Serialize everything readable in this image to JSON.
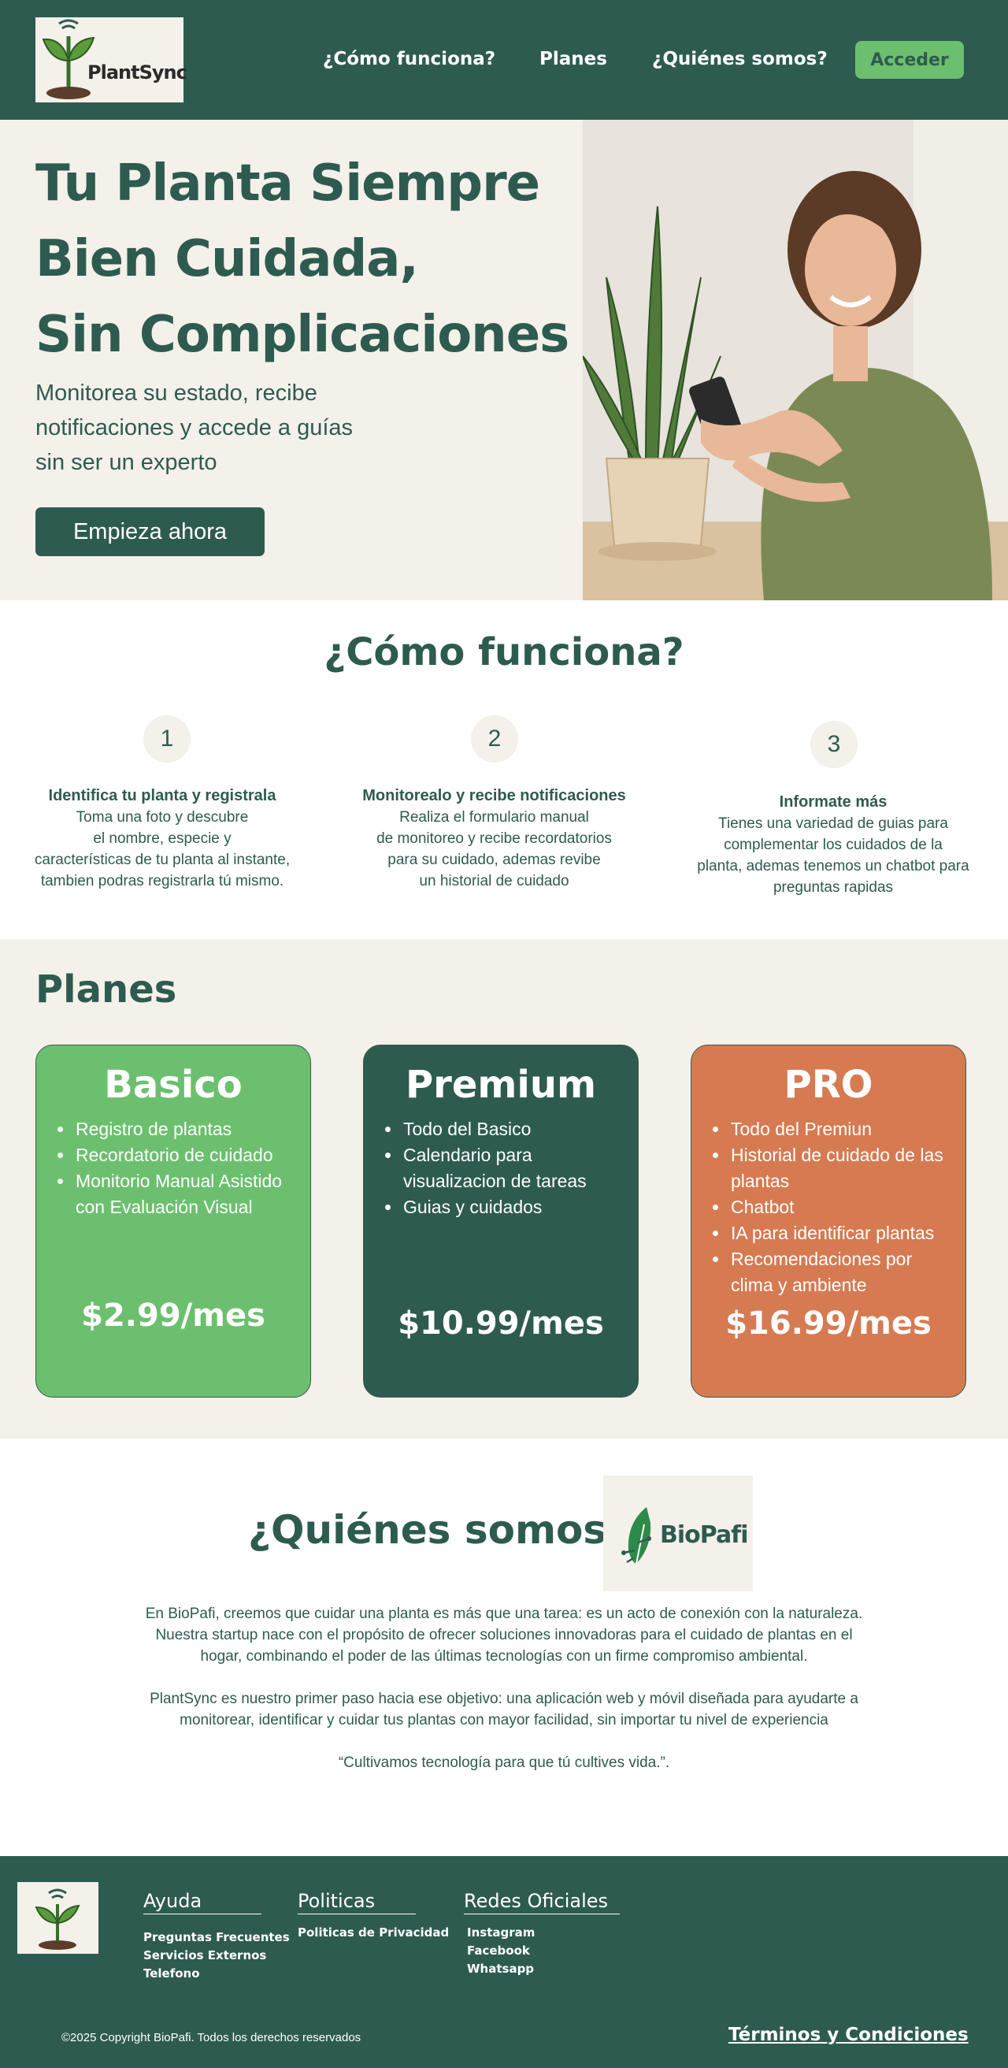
{
  "header": {
    "logo_text": "PlantSync",
    "nav": [
      "¿Cómo funciona?",
      "Planes",
      "¿Quiénes somos?"
    ],
    "login_button": "Acceder"
  },
  "hero": {
    "title_lines": [
      "Tu Planta Siempre",
      "Bien Cuidada,",
      "Sin Complicaciones"
    ],
    "subtitle_lines": [
      "Monitorea su estado, recibe",
      "notificaciones y accede a guías",
      "sin ser un experto"
    ],
    "cta_button": "Empieza ahora",
    "image": "woman-holding-phone-with-snake-plant-photo"
  },
  "how_it_works": {
    "title": "¿Cómo funciona?",
    "steps": [
      {
        "number": "1",
        "title": "Identifica tu planta y registrala",
        "lines": [
          "Toma una foto y descubre",
          "el nombre, especie y",
          "características de tu planta al instante,",
          "tambien podras registrarla tú mismo."
        ]
      },
      {
        "number": "2",
        "title": "Monitorealo y recibe notificaciones",
        "lines": [
          "Realiza el formulario manual",
          "de monitoreo y recibe recordatorios",
          "para su cuidado, ademas revibe",
          "un historial de cuidado"
        ]
      },
      {
        "number": "3",
        "title": "Informate más",
        "lines": [
          "Tienes una variedad de guias para",
          "complementar los cuidados de la",
          "planta, ademas tenemos un chatbot para",
          "preguntas rapidas"
        ]
      }
    ]
  },
  "plans": {
    "title": "Planes",
    "cards": [
      {
        "name": "Basico",
        "features": [
          "Registro de plantas",
          "Recordatorio de cuidado",
          "Monitorio Manual Asistido con Evaluación Visual"
        ],
        "price": "$2.99/mes",
        "color": "#6cbf6e"
      },
      {
        "name": "Premium",
        "features": [
          "Todo del Basico",
          "Calendario para visualizacion de tareas",
          "Guias y cuidados"
        ],
        "price": "$10.99/mes",
        "color": "#2e5b4f"
      },
      {
        "name": "PRO",
        "features": [
          "Todo del Premiun",
          "Historial de cuidado de las plantas",
          "Chatbot",
          "IA para identificar plantas",
          "Recomendaciones por clima y ambiente"
        ],
        "price": "$16.99/mes",
        "color": "#d67a52"
      }
    ]
  },
  "about": {
    "title": "¿Quiénes somos?",
    "brand_logo_text": "BioPafi",
    "paragraphs": [
      [
        "En BioPafi, creemos que cuidar una planta es más que una tarea: es un acto de conexión con la naturaleza.",
        "Nuestra startup nace con el propósito de ofrecer soluciones innovadoras para el cuidado de plantas en el",
        "hogar, combinando el poder de las últimas tecnologías con un firme compromiso ambiental."
      ],
      [
        "PlantSync es nuestro primer paso hacia ese objetivo: una aplicación web y móvil diseñada para ayudarte a",
        "monitorear, identificar y cuidar tus plantas con mayor facilidad, sin importar tu nivel de experiencia"
      ],
      [
        "“Cultivamos tecnología para que tú cultives vida.”."
      ]
    ]
  },
  "footer": {
    "columns": [
      {
        "title": "Ayuda",
        "links": [
          "Preguntas Frecuentes",
          "Servicios Externos",
          "Telefono"
        ]
      },
      {
        "title": "Politicas",
        "links": [
          "Politicas de Privacidad"
        ]
      },
      {
        "title": "Redes Oficiales",
        "links": [
          "Instagram",
          "Facebook",
          "Whatsapp"
        ]
      }
    ],
    "copyright": "©2025 Copyright BioPafi. Todos los derechos reservados",
    "terms": "Términos y Condiciones"
  },
  "colors": {
    "primary": "#2e5b4f",
    "cream": "#f4f0ea",
    "green": "#6cbf6e",
    "orange": "#d67a52"
  }
}
